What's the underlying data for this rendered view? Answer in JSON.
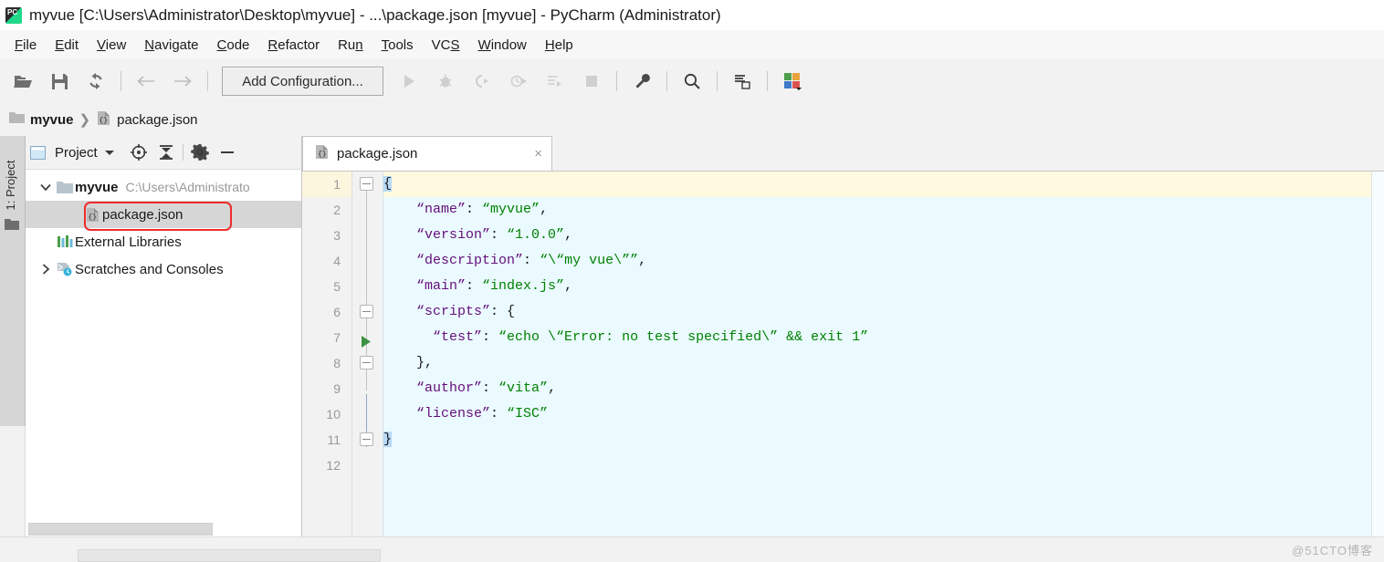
{
  "window": {
    "title": "myvue [C:\\Users\\Administrator\\Desktop\\myvue] - ...\\package.json [myvue] - PyCharm (Administrator)",
    "app_icon": "pycharm-icon",
    "icon_text": "PC"
  },
  "menubar": {
    "items": [
      {
        "label": "File",
        "mnemonic": "F"
      },
      {
        "label": "Edit",
        "mnemonic": "E"
      },
      {
        "label": "View",
        "mnemonic": "V"
      },
      {
        "label": "Navigate",
        "mnemonic": "N"
      },
      {
        "label": "Code",
        "mnemonic": "C"
      },
      {
        "label": "Refactor",
        "mnemonic": "R"
      },
      {
        "label": "Run",
        "mnemonic": "n"
      },
      {
        "label": "Tools",
        "mnemonic": "T"
      },
      {
        "label": "VCS",
        "mnemonic": "S"
      },
      {
        "label": "Window",
        "mnemonic": "W"
      },
      {
        "label": "Help",
        "mnemonic": "H"
      }
    ]
  },
  "toolbar": {
    "run_config_label": "Add Configuration...",
    "icons": [
      "open-folder-icon",
      "save-icon",
      "sync-icon",
      "back-arrow-icon",
      "forward-arrow-icon",
      "run-icon",
      "debug-icon",
      "run-coverage-icon",
      "profile-icon",
      "run-with-icon",
      "stop-icon",
      "settings-wrench-icon",
      "search-icon",
      "commit-icon",
      "plugins-icon"
    ]
  },
  "breadcrumb": {
    "items": [
      {
        "label": "myvue",
        "icon": "folder-icon",
        "bold": true
      },
      {
        "label": "package.json",
        "icon": "json-file-icon",
        "bold": false
      }
    ],
    "separator": "❯"
  },
  "sidebar": {
    "vertical_label": "1: Project",
    "icon": "project-folder-icon"
  },
  "project_panel": {
    "title": "Project",
    "header_icons": [
      "project-view-icon",
      "chevron-down-icon",
      "locate-target-icon",
      "collapse-all-icon",
      "gear-icon",
      "minimize-icon"
    ],
    "tree": [
      {
        "label": "myvue",
        "path": "C:\\Users\\Administrato",
        "icon": "folder-icon",
        "arrow": "expanded",
        "indent": 0,
        "bold": true,
        "selected": false,
        "annotated": false
      },
      {
        "label": "package.json",
        "path": "",
        "icon": "json-file-icon",
        "arrow": "none",
        "indent": 1,
        "bold": false,
        "selected": true,
        "annotated": true
      },
      {
        "label": "External Libraries",
        "path": "",
        "icon": "libraries-icon",
        "arrow": "none",
        "indent": 0,
        "bold": false,
        "selected": false,
        "annotated": false
      },
      {
        "label": "Scratches and Consoles",
        "path": "",
        "icon": "scratches-icon",
        "arrow": "collapsed",
        "indent": 0,
        "bold": false,
        "selected": false,
        "annotated": false
      }
    ],
    "annotation_color": "#ef2b2b"
  },
  "editor": {
    "tabs": [
      {
        "label": "package.json",
        "icon": "json-file-icon",
        "active": true,
        "close": "×"
      }
    ],
    "current_line": 1,
    "line_numbers": [
      "1",
      "2",
      "3",
      "4",
      "5",
      "6",
      "7",
      "8",
      "9",
      "10",
      "11",
      "12"
    ],
    "gutter_run_line": 7,
    "lines": [
      {
        "n": "1",
        "tokens": [
          {
            "t": "{",
            "c": "brace-match"
          }
        ]
      },
      {
        "n": "2",
        "tokens": [
          {
            "t": "    ",
            "c": "p"
          },
          {
            "t": "“name”",
            "c": "k"
          },
          {
            "t": ": ",
            "c": "p"
          },
          {
            "t": "“myvue”",
            "c": "s"
          },
          {
            "t": ",",
            "c": "p"
          }
        ]
      },
      {
        "n": "3",
        "tokens": [
          {
            "t": "    ",
            "c": "p"
          },
          {
            "t": "“version”",
            "c": "k"
          },
          {
            "t": ": ",
            "c": "p"
          },
          {
            "t": "“1.0.0”",
            "c": "s"
          },
          {
            "t": ",",
            "c": "p"
          }
        ]
      },
      {
        "n": "4",
        "tokens": [
          {
            "t": "    ",
            "c": "p"
          },
          {
            "t": "“description”",
            "c": "k"
          },
          {
            "t": ": ",
            "c": "p"
          },
          {
            "t": "“\\“my vue\\””",
            "c": "s"
          },
          {
            "t": ",",
            "c": "p"
          }
        ]
      },
      {
        "n": "5",
        "tokens": [
          {
            "t": "    ",
            "c": "p"
          },
          {
            "t": "“main”",
            "c": "k"
          },
          {
            "t": ": ",
            "c": "p"
          },
          {
            "t": "“index.js”",
            "c": "s"
          },
          {
            "t": ",",
            "c": "p"
          }
        ]
      },
      {
        "n": "6",
        "tokens": [
          {
            "t": "    ",
            "c": "p"
          },
          {
            "t": "“scripts”",
            "c": "k"
          },
          {
            "t": ": {",
            "c": "p"
          }
        ]
      },
      {
        "n": "7",
        "tokens": [
          {
            "t": "      ",
            "c": "p"
          },
          {
            "t": "“test”",
            "c": "k"
          },
          {
            "t": ": ",
            "c": "p"
          },
          {
            "t": "“echo \\“Error: no test specified\\” && exit 1”",
            "c": "s"
          }
        ]
      },
      {
        "n": "8",
        "tokens": [
          {
            "t": "    },",
            "c": "p"
          }
        ]
      },
      {
        "n": "9",
        "tokens": [
          {
            "t": "    ",
            "c": "p"
          },
          {
            "t": "“author”",
            "c": "k"
          },
          {
            "t": ": ",
            "c": "p"
          },
          {
            "t": "“vita”",
            "c": "s"
          },
          {
            "t": ",",
            "c": "p"
          }
        ]
      },
      {
        "n": "10",
        "tokens": [
          {
            "t": "    ",
            "c": "p"
          },
          {
            "t": "“license”",
            "c": "k"
          },
          {
            "t": ": ",
            "c": "p"
          },
          {
            "t": "“ISC”",
            "c": "s"
          }
        ]
      },
      {
        "n": "11",
        "tokens": [
          {
            "t": "}",
            "c": "brace-match"
          }
        ]
      },
      {
        "n": "12",
        "tokens": []
      }
    ],
    "colors": {
      "background": "#eafaff",
      "current_line": "#fff9e0",
      "gutter": "#f2f2f2",
      "line_number": "#999999",
      "key": "#660e7a",
      "string": "#008000",
      "punctuation": "#1a1a1a",
      "brace_match": "#b8d9f7"
    }
  },
  "footer": {
    "watermark": "@51CTO博客"
  }
}
